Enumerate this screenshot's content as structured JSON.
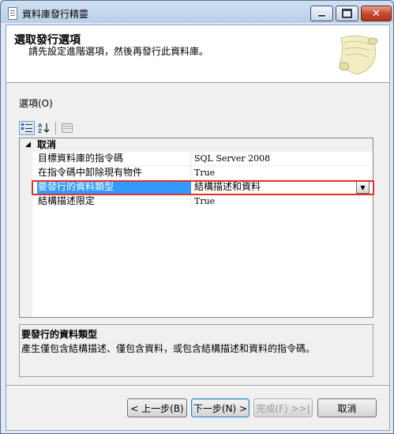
{
  "window": {
    "title": "資料庫發行精靈",
    "icon": "document-icon"
  },
  "header": {
    "title": "選取發行選項",
    "subtitle": "請先設定進階選項，然後再發行此資料庫。"
  },
  "options": {
    "label": "選項(O)",
    "toolbar": [
      "categorized-icon",
      "alphabetical-icon",
      "property-pages-icon"
    ],
    "category": "取消",
    "properties": [
      {
        "name": "目標資料庫的指令碼",
        "value": "SQL Server 2008"
      },
      {
        "name": "在指令碼中卸除現有物件",
        "value": "True"
      },
      {
        "name": "要發行的資料類型",
        "value": "結構描述和資料"
      },
      {
        "name": "結構描述限定",
        "value": "True"
      }
    ],
    "selected_index": 2
  },
  "description": {
    "title": "要發行的資料類型",
    "text": "產生僅包含結構描述、僅包含資料，或包含結構描述和資料的指令碼。"
  },
  "buttons": {
    "back": "< 上一步(B)",
    "next": "下一步(N) >",
    "finish": "完成(F) >>|",
    "cancel": "取消"
  },
  "colors": {
    "selection": "#3399ff",
    "highlight_box": "#e03131"
  }
}
